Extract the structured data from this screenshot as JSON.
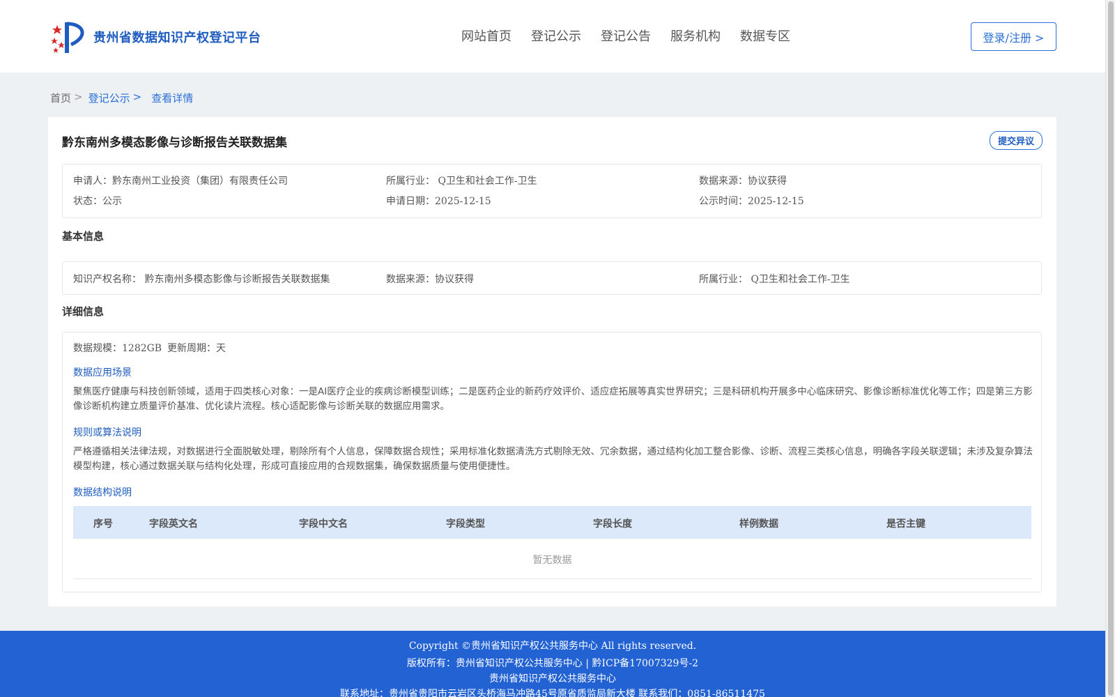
{
  "header": {
    "logo_text": "贵州省数据知识产权登记平台",
    "nav": [
      "网站首页",
      "登记公示",
      "登记公告",
      "服务机构",
      "数据专区"
    ],
    "login_label": "登录/注册 >"
  },
  "breadcrumb": {
    "home": "首页",
    "sep": ">",
    "items": [
      "登记公示",
      "查看详情"
    ]
  },
  "record": {
    "title": "黔东南州多模态影像与诊断报告关联数据集",
    "objection_label": "提交异议",
    "applicant": "申请人：黔东南州工业投资（集团）有限责任公司",
    "industry": "所属行业： Q卫生和社会工作-卫生",
    "source": "数据来源：协议获得",
    "status": "状态：公示",
    "apply_date": "申请日期：2025-12-15",
    "publish_date": "公示时间：2025-12-15"
  },
  "basic": {
    "section_title": "基本信息",
    "ip_name": "知识产权名称： 黔东南州多模态影像与诊断报告关联数据集",
    "source": "数据来源：协议获得",
    "industry": "所属行业： Q卫生和社会工作-卫生"
  },
  "detail": {
    "section_title": "详细信息",
    "scale": "数据规模：1282GB",
    "cycle": "更新周期：天",
    "scenario_title": "数据应用场景",
    "scenario_text": "聚焦医疗健康与科技创新领域，适用于四类核心对象：一是AI医疗企业的疾病诊断模型训练；二是医药企业的新药疗效评价、适应症拓展等真实世界研究；三是科研机构开展多中心临床研究、影像诊断标准优化等工作；四是第三方影像诊断机构建立质量评价基准、优化读片流程。核心适配影像与诊断关联的数据应用需求。",
    "rules_title": "规则或算法说明",
    "rules_text": "严格遵循相关法律法规，对数据进行全面脱敏处理，剔除所有个人信息，保障数据合规性；采用标准化数据清洗方式剔除无效、冗余数据，通过结构化加工整合影像、诊断、流程三类核心信息，明确各字段关联逻辑；未涉及复杂算法模型构建，核心通过数据关联与结构化处理，形成可直接应用的合规数据集，确保数据质量与使用便捷性。",
    "structure_title": "数据结构说明",
    "table_headers": [
      "序号",
      "字段英文名",
      "字段中文名",
      "字段类型",
      "字段长度",
      "样例数据",
      "是否主键"
    ],
    "empty_text": "暂无数据"
  },
  "footer": {
    "line1": "Copyright ©贵州省知识产权公共服务中心 All rights reserved.",
    "line2": "版权所有：贵州省知识产权公共服务中心 | 黔ICP备17007329号-2",
    "line3": "贵州省知识产权公共服务中心",
    "line4": "联系地址：贵州省贵阳市云岩区头桥海马冲路45号原省质监局新大楼 联系我们：0851-86511475"
  },
  "colors": {
    "brand_blue": "#1f5cbf",
    "footer_blue": "#2262d2",
    "table_header_bg": "#dce9fa"
  }
}
